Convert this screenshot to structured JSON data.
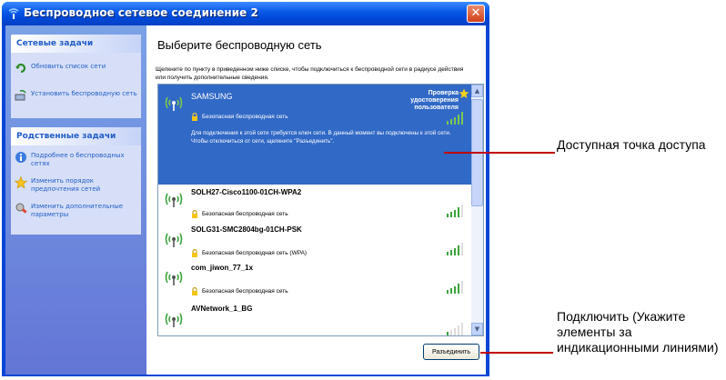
{
  "window": {
    "title": "Беспроводное сетевое соединение 2",
    "close_glyph": "✕"
  },
  "sidebar": {
    "network_tasks": {
      "header": "Сетевые задачи",
      "items": [
        {
          "label": "Обновить список сети",
          "icon": "refresh-icon"
        },
        {
          "label": "Установить беспроводную сеть",
          "icon": "setup-network-icon"
        }
      ]
    },
    "related_tasks": {
      "header": "Родственные задачи",
      "items": [
        {
          "label": "Подробнее о беспроводных сетях",
          "icon": "info-icon"
        },
        {
          "label": "Изменить порядок предпочтения сетей",
          "icon": "star-icon"
        },
        {
          "label": "Изменить дополнительные параметры",
          "icon": "settings-icon"
        }
      ]
    }
  },
  "main": {
    "heading": "Выберите беспроводную сеть",
    "intro": "Щелкните по пункту в приведенном ниже списке, чтобы подключиться к беспроводной сети в радиусе действия или получить дополнительные сведения.",
    "selected_network": {
      "ssid": "SAMSUNG",
      "security": "Безопасная беспроводная сеть",
      "verify": "Проверка удостоверения пользователя",
      "description": "Для подключения к этой сети требуется ключ сети. В данный момент вы подключены к этой сети. Чтобы отключиться от сети, щелкните \"Разъединить\"."
    },
    "networks": [
      {
        "ssid": "SOLH27-Cisco1100-01CH-WPA2",
        "security": "Безопасная беспроводная сеть"
      },
      {
        "ssid": "SOLG31-SMC2804bg-01CH-PSK",
        "security": "Безопасная беспроводная сеть (WPA)"
      },
      {
        "ssid": "com_jiwon_77_1x",
        "security": "Безопасная беспроводная сеть"
      },
      {
        "ssid": "AVNetwork_1_BG",
        "security": ""
      }
    ],
    "disconnect_button": "Разъединить"
  },
  "callouts": {
    "access_point": "Доступная точка доступа",
    "connect": "Подключить (Укажите элементы за индикационными линиями)"
  },
  "colors": {
    "title_bar": "#0a5ae8",
    "selection": "#3169c6",
    "task_link": "#215dc6",
    "callout_line": "#c00000"
  }
}
